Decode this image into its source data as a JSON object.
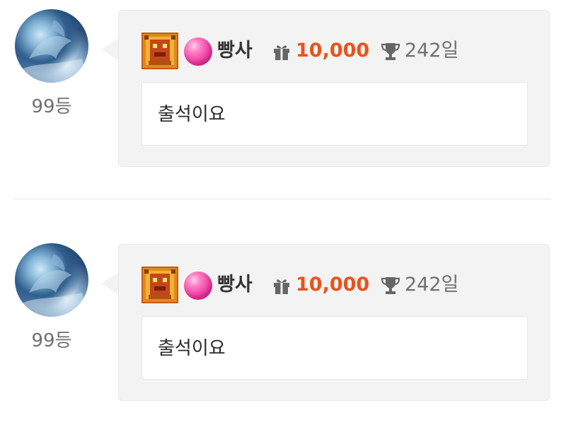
{
  "comments": [
    {
      "rank": "99등",
      "nickname": "빵사",
      "points": "10,000",
      "days": "242일",
      "text": "출석이요",
      "icons": {
        "level": "level-badge-icon",
        "candy": "candy-icon",
        "gift": "gift-icon",
        "trophy": "trophy-icon"
      }
    },
    {
      "rank": "99등",
      "nickname": "빵사",
      "points": "10,000",
      "days": "242일",
      "text": "출석이요",
      "icons": {
        "level": "level-badge-icon",
        "candy": "candy-icon",
        "gift": "gift-icon",
        "trophy": "trophy-icon"
      }
    }
  ],
  "colors": {
    "points": "#e8531a",
    "bubble_bg": "#f3f3f3",
    "muted_text": "#707070",
    "candy": "#ec3ea0"
  }
}
